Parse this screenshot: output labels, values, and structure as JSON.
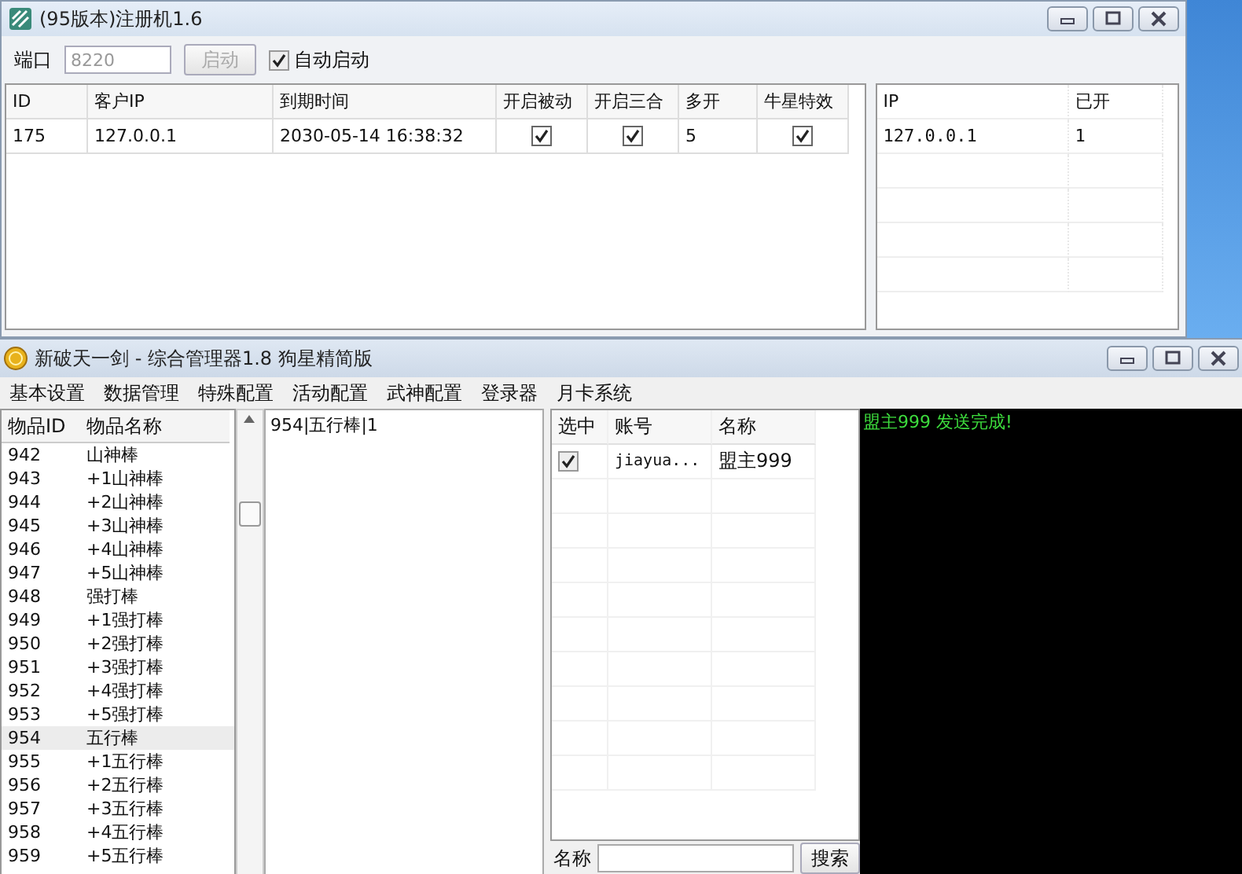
{
  "register_window": {
    "title": "(95版本)注册机1.6",
    "port_label": "端口",
    "port_field": {
      "value": "8220"
    },
    "start_button": {
      "label": "启动",
      "disabled": true
    },
    "auto_start": {
      "label": "自动启动",
      "checked": true
    },
    "clients_table": {
      "columns": [
        "ID",
        "客户IP",
        "到期时间",
        "开启被动",
        "开启三合",
        "多开",
        "牛星特效"
      ],
      "rows": [
        {
          "cells": [
            {
              "kind": "text",
              "text": "175"
            },
            {
              "kind": "text",
              "text": "127.0.0.1"
            },
            {
              "kind": "text",
              "text": "2030-05-14 16:38:32"
            },
            {
              "kind": "check",
              "checked": true
            },
            {
              "kind": "check",
              "checked": true
            },
            {
              "kind": "text",
              "text": "5"
            },
            {
              "kind": "check",
              "checked": true
            }
          ]
        }
      ]
    },
    "ip_table": {
      "columns": [
        "IP",
        "已开"
      ],
      "rows": [
        [
          "127.0.0.1",
          "1"
        ]
      ]
    }
  },
  "manager_window": {
    "title": "新破天一剑 - 综合管理器1.8 狗星精简版",
    "menu": [
      "基本设置",
      "数据管理",
      "特殊配置",
      "活动配置",
      "武神配置",
      "登录器",
      "月卡系统"
    ],
    "items_table": {
      "columns": [
        "物品ID",
        "物品名称"
      ],
      "rows": [
        {
          "id": "942",
          "name": "山神棒",
          "selected": false
        },
        {
          "id": "943",
          "name": "+1山神棒",
          "selected": false
        },
        {
          "id": "944",
          "name": "+2山神棒",
          "selected": false
        },
        {
          "id": "945",
          "name": "+3山神棒",
          "selected": false
        },
        {
          "id": "946",
          "name": "+4山神棒",
          "selected": false
        },
        {
          "id": "947",
          "name": "+5山神棒",
          "selected": false
        },
        {
          "id": "948",
          "name": "强打棒",
          "selected": false
        },
        {
          "id": "949",
          "name": "+1强打棒",
          "selected": false
        },
        {
          "id": "950",
          "name": "+2强打棒",
          "selected": false
        },
        {
          "id": "951",
          "name": "+3强打棒",
          "selected": false
        },
        {
          "id": "952",
          "name": "+4强打棒",
          "selected": false
        },
        {
          "id": "953",
          "name": "+5强打棒",
          "selected": false
        },
        {
          "id": "954",
          "name": "五行棒",
          "selected": true
        },
        {
          "id": "955",
          "name": "+1五行棒",
          "selected": false
        },
        {
          "id": "956",
          "name": "+2五行棒",
          "selected": false
        },
        {
          "id": "957",
          "name": "+3五行棒",
          "selected": false
        },
        {
          "id": "958",
          "name": "+4五行棒",
          "selected": false
        },
        {
          "id": "959",
          "name": "+5五行棒",
          "selected": false
        }
      ]
    },
    "detail_text": "954|五行棒|1",
    "accounts_table": {
      "columns": [
        "选中",
        "账号",
        "名称"
      ],
      "rows": [
        {
          "checked": true,
          "account": "jiayua...",
          "name": "盟主999"
        }
      ]
    },
    "search": {
      "label": "名称",
      "button": "搜索"
    },
    "console_lines": [
      "盟主999 发送完成!"
    ]
  }
}
